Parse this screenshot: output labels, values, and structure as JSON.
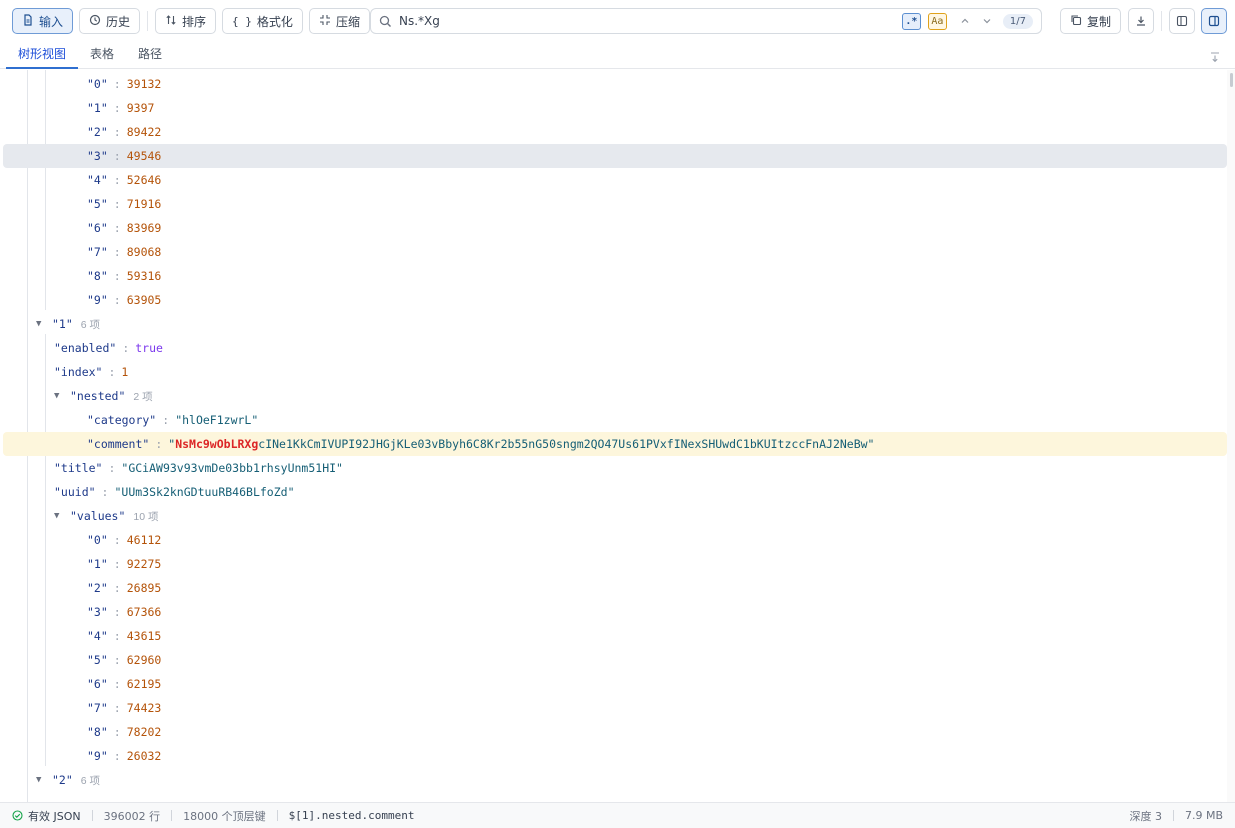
{
  "toolbar": {
    "input_label": "输入",
    "history_label": "历史",
    "sort_label": "排序",
    "format_label": "格式化",
    "compress_label": "压缩",
    "copy_label": "复制",
    "format_icon_text": "{ }"
  },
  "search": {
    "query": "Ns.*Xg",
    "regex_label": ".*",
    "case_label": "Aa",
    "match_count": "1/7"
  },
  "tabs": [
    "树形视图",
    "表格",
    "路径"
  ],
  "tree": {
    "rows": [
      {
        "type": "leaf",
        "depth": 3,
        "key": "\"0\"",
        "value": "39132",
        "vtype": "num"
      },
      {
        "type": "leaf",
        "depth": 3,
        "key": "\"1\"",
        "value": "9397",
        "vtype": "num"
      },
      {
        "type": "leaf",
        "depth": 3,
        "key": "\"2\"",
        "value": "89422",
        "vtype": "num"
      },
      {
        "type": "leaf",
        "depth": 3,
        "key": "\"3\"",
        "value": "49546",
        "vtype": "num",
        "selected": true
      },
      {
        "type": "leaf",
        "depth": 3,
        "key": "\"4\"",
        "value": "52646",
        "vtype": "num"
      },
      {
        "type": "leaf",
        "depth": 3,
        "key": "\"5\"",
        "value": "71916",
        "vtype": "num"
      },
      {
        "type": "leaf",
        "depth": 3,
        "key": "\"6\"",
        "value": "83969",
        "vtype": "num"
      },
      {
        "type": "leaf",
        "depth": 3,
        "key": "\"7\"",
        "value": "89068",
        "vtype": "num"
      },
      {
        "type": "leaf",
        "depth": 3,
        "key": "\"8\"",
        "value": "59316",
        "vtype": "num"
      },
      {
        "type": "leaf",
        "depth": 3,
        "key": "\"9\"",
        "value": "63905",
        "vtype": "num"
      },
      {
        "type": "node",
        "depth": 1,
        "key": "\"1\"",
        "count": "6 项"
      },
      {
        "type": "leaf",
        "depth": 2,
        "key": "\"enabled\"",
        "value": "true",
        "vtype": "bool"
      },
      {
        "type": "leaf",
        "depth": 2,
        "key": "\"index\"",
        "value": "1",
        "vtype": "num"
      },
      {
        "type": "node",
        "depth": 2,
        "key": "\"nested\"",
        "count": "2 项"
      },
      {
        "type": "leaf",
        "depth": 3,
        "key": "\"category\"",
        "value": "\"hlOeF1zwrL\"",
        "vtype": "str"
      },
      {
        "type": "leaf",
        "depth": 3,
        "key": "\"comment\"",
        "value_prefix": "\"",
        "value_match": "NsMc9wObLRXg",
        "value_rest": "cINe1KkCmIVUPI92JHGjKLe03vBbyh6C8Kr2b55nG50sngm2QO47Us61PVxfINexSHUwdC1bKUItzccFnAJ2NeBw\"",
        "vtype": "str",
        "match": true
      },
      {
        "type": "leaf",
        "depth": 2,
        "key": "\"title\"",
        "value": "\"GCiAW93v93vmDe03bb1rhsyUnm51HI\"",
        "vtype": "str"
      },
      {
        "type": "leaf",
        "depth": 2,
        "key": "\"uuid\"",
        "value": "\"UUm3Sk2knGDtuuRB46BLfoZd\"",
        "vtype": "str"
      },
      {
        "type": "node",
        "depth": 2,
        "key": "\"values\"",
        "count": "10 项"
      },
      {
        "type": "leaf",
        "depth": 3,
        "key": "\"0\"",
        "value": "46112",
        "vtype": "num"
      },
      {
        "type": "leaf",
        "depth": 3,
        "key": "\"1\"",
        "value": "92275",
        "vtype": "num"
      },
      {
        "type": "leaf",
        "depth": 3,
        "key": "\"2\"",
        "value": "26895",
        "vtype": "num"
      },
      {
        "type": "leaf",
        "depth": 3,
        "key": "\"3\"",
        "value": "67366",
        "vtype": "num"
      },
      {
        "type": "leaf",
        "depth": 3,
        "key": "\"4\"",
        "value": "43615",
        "vtype": "num"
      },
      {
        "type": "leaf",
        "depth": 3,
        "key": "\"5\"",
        "value": "62960",
        "vtype": "num"
      },
      {
        "type": "leaf",
        "depth": 3,
        "key": "\"6\"",
        "value": "62195",
        "vtype": "num"
      },
      {
        "type": "leaf",
        "depth": 3,
        "key": "\"7\"",
        "value": "74423",
        "vtype": "num"
      },
      {
        "type": "leaf",
        "depth": 3,
        "key": "\"8\"",
        "value": "78202",
        "vtype": "num"
      },
      {
        "type": "leaf",
        "depth": 3,
        "key": "\"9\"",
        "value": "26032",
        "vtype": "num"
      },
      {
        "type": "node",
        "depth": 1,
        "key": "\"2\"",
        "count": "6 项"
      }
    ]
  },
  "status": {
    "valid_label": "有效 JSON",
    "lines": "396002 行",
    "top_keys": "18000 个顶层键",
    "path": "$[1].nested.comment",
    "depth": "深度 3",
    "size": "7.9 MB"
  },
  "colors": {
    "accent": "#2f6fd0",
    "match_highlight": "#dc2626",
    "match_row_bg": "#fdf6dc",
    "selected_row_bg": "#e6e9ee"
  }
}
